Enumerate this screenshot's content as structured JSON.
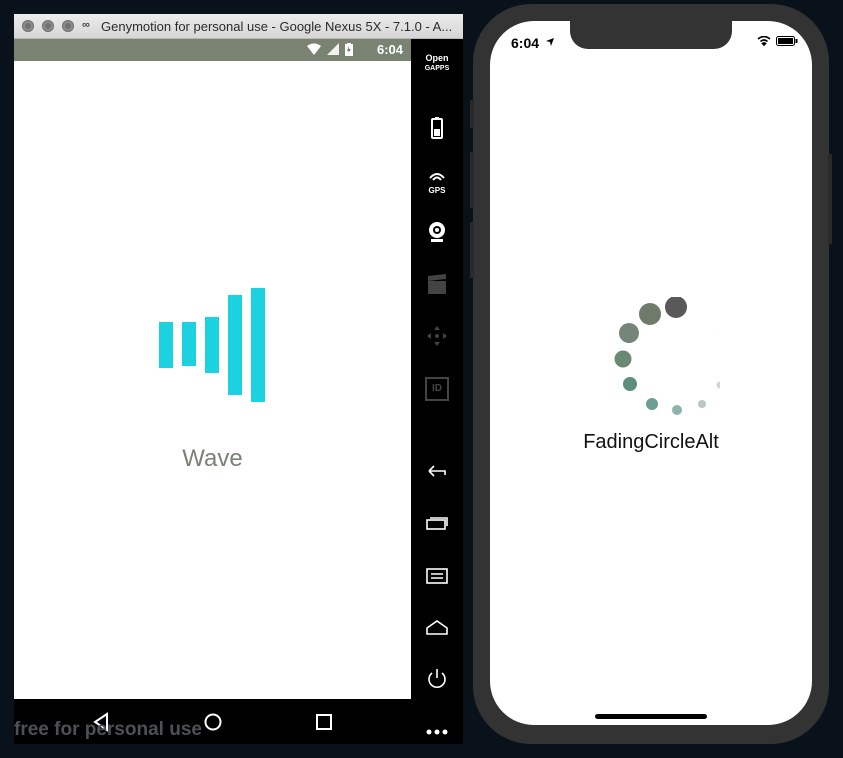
{
  "genymotion": {
    "title": "Genymotion for personal use - Google Nexus 5X - 7.1.0 - A...",
    "logo": "∞",
    "status_time": "6:04",
    "screen_label": "Wave",
    "watermark": "free for personal use",
    "accent_color": "#1dd2e0",
    "sidebar": {
      "opengapps_line1": "Open",
      "opengapps_line2": "GAPPS",
      "gps_label": "GPS",
      "id_label": "ID"
    }
  },
  "iphone": {
    "status_time": "6:04",
    "screen_label": "FadingCircleAlt",
    "spinner_color": "#6b8872"
  }
}
